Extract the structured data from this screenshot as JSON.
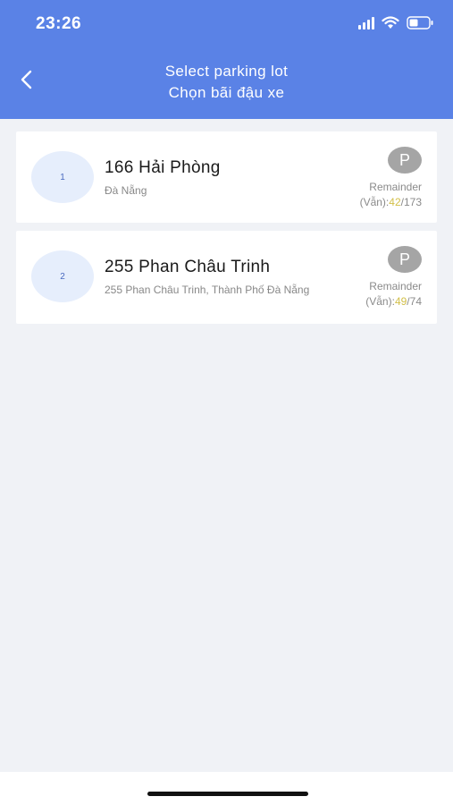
{
  "status_bar": {
    "time": "23:26"
  },
  "header": {
    "title_en": "Select parking lot",
    "title_vi": "Chọn bãi đậu xe"
  },
  "lots": [
    {
      "index": "1",
      "name": "166 Hải Phòng",
      "address": "Đà Nẵng",
      "parking_icon": "P",
      "remainder_label": "Remainder",
      "remainder_prefix": "(Vẫn):",
      "available": "42",
      "separator": "/",
      "total": "173"
    },
    {
      "index": "2",
      "name": "255 Phan Châu Trinh",
      "address": "255 Phan Châu Trinh, Thành Phố Đà Nẵng",
      "parking_icon": "P",
      "remainder_label": "Remainder",
      "remainder_prefix": "(Vẫn):",
      "available": "49",
      "separator": "/",
      "total": "74"
    }
  ],
  "colors": {
    "header_bg": "#5a82e6",
    "available": "#d2bf48",
    "badge_bg": "#e6eefc",
    "parking_icon_bg": "#a5a5a5"
  }
}
